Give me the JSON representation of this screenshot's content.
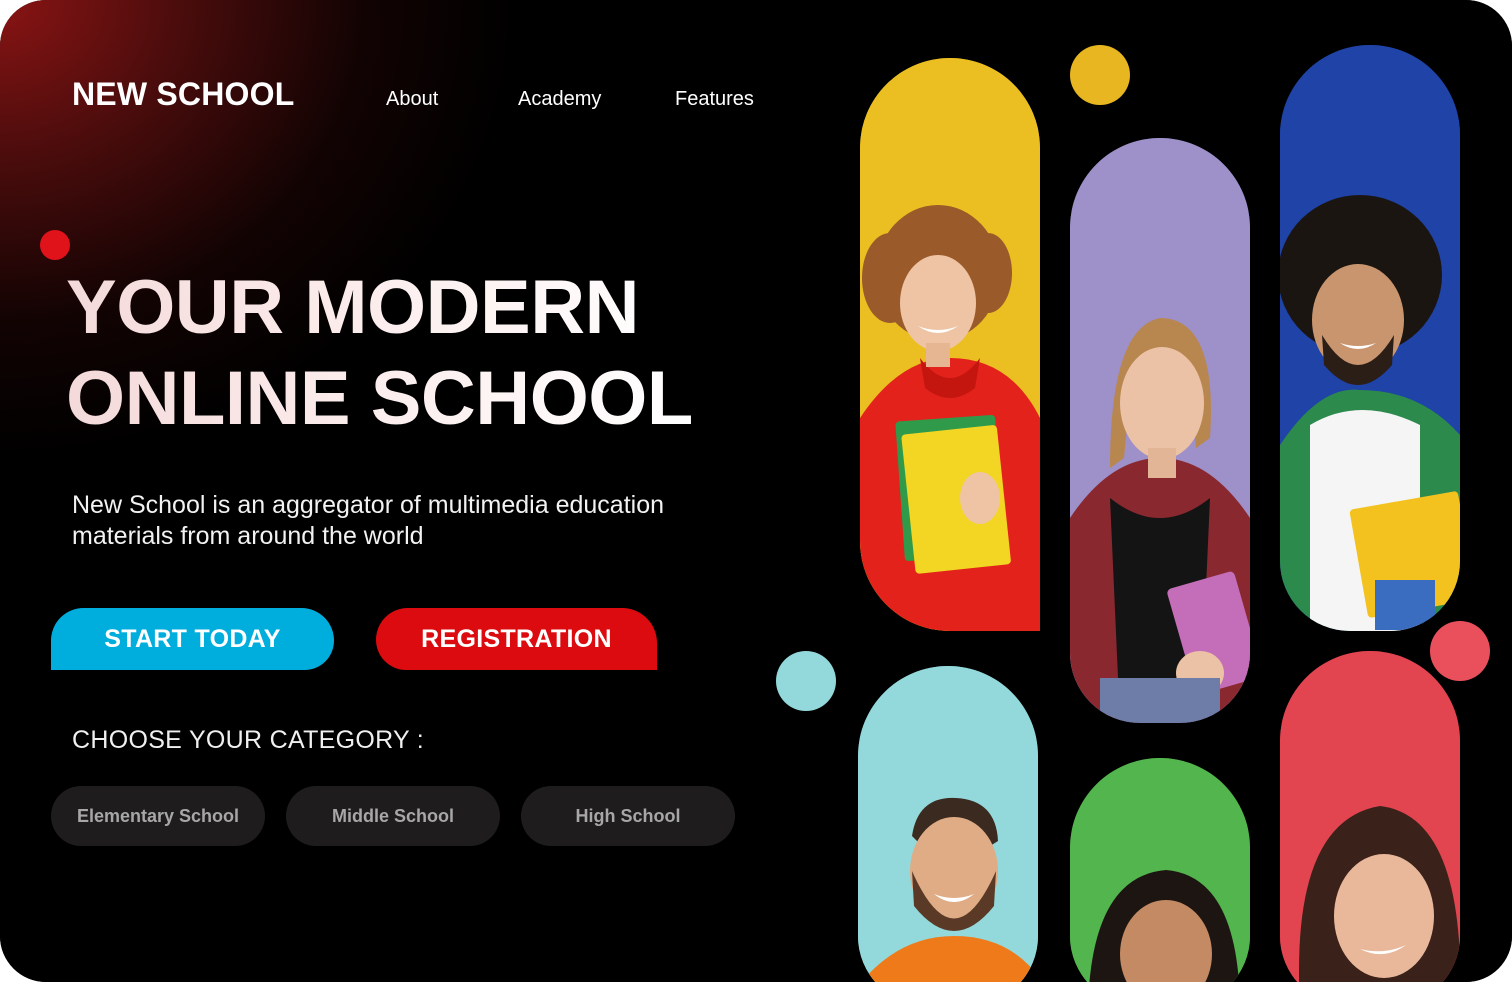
{
  "brand": {
    "logo": "NEW SCHOOL"
  },
  "nav": {
    "items": [
      {
        "label": "About"
      },
      {
        "label": "Academy"
      },
      {
        "label": "Features"
      }
    ]
  },
  "hero": {
    "headline_lines": [
      "YOUR MODERN",
      "ONLINE SCHOOL"
    ],
    "description_lines": [
      "New School is an aggregator of multimedia education",
      "materials from around the world"
    ],
    "cta_primary": "START TODAY",
    "cta_secondary": "REGISTRATION"
  },
  "categories": {
    "heading": "CHOOSE YOUR CATEGORY :",
    "items": [
      {
        "label": "Elementary School"
      },
      {
        "label": "Middle School"
      },
      {
        "label": "High School"
      }
    ]
  },
  "colors": {
    "background": "#000000",
    "glow": "#8a1414",
    "primary_button": "#00aede",
    "secondary_button": "#dc0b0f",
    "pill_bg": "#1e1c1c",
    "capsule_yellow": "#ebbf22",
    "capsule_lavender": "#9e90c9",
    "capsule_blue": "#1f43a6",
    "capsule_cyan": "#93d9dc",
    "capsule_green": "#53b54e",
    "capsule_red": "#e24450",
    "dot_red_small": "#e0131a",
    "dot_yellow": "#e8b620",
    "dot_cyan": "#93d9dc",
    "dot_coral": "#e9505b"
  },
  "photos": [
    {
      "name": "student-woman-curly-red-hoodie-photo"
    },
    {
      "name": "student-woman-plaid-shirt-photo"
    },
    {
      "name": "student-man-curly-green-shirt-photo"
    },
    {
      "name": "student-man-beard-orange-sweater-photo"
    },
    {
      "name": "student-woman-dark-hair-photo"
    },
    {
      "name": "student-woman-brown-hair-photo"
    }
  ]
}
